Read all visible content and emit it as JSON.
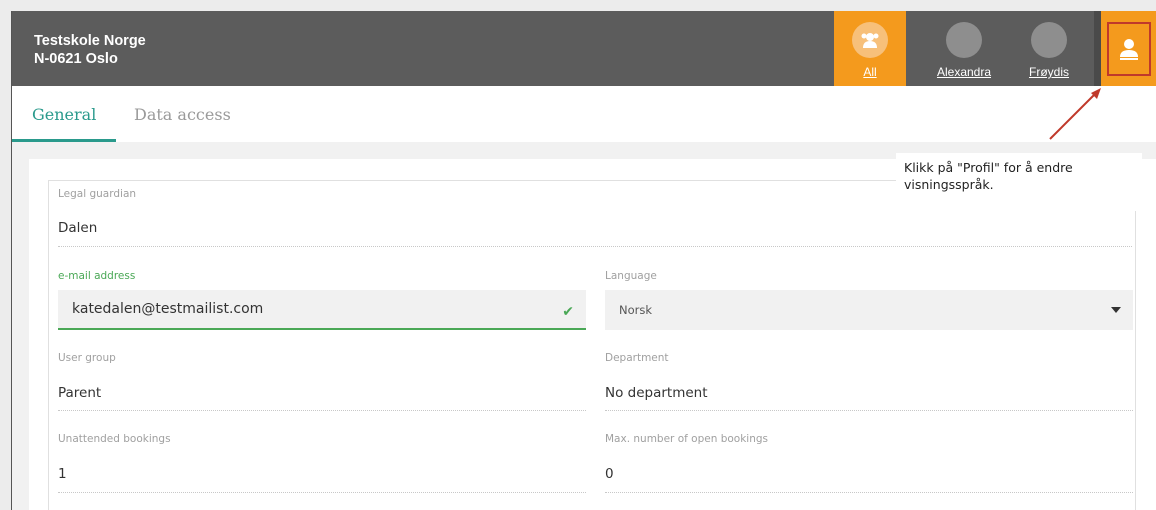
{
  "header": {
    "school_name": "Testskole Norge",
    "school_address": "N-0621 Oslo",
    "users": [
      {
        "label": "All",
        "icon": "group-icon",
        "active": true
      },
      {
        "label": "Alexandra",
        "icon": "avatar-placeholder"
      },
      {
        "label": "Frøydis",
        "icon": "avatar-placeholder"
      }
    ],
    "profile_icon": "person-icon",
    "accent": "#f49a1d"
  },
  "tabs": [
    {
      "label": "General",
      "active": true
    },
    {
      "label": "Data access",
      "active": false
    }
  ],
  "form": {
    "legal_guardian": {
      "label": "Legal guardian",
      "value": "Dalen"
    },
    "email": {
      "label": "e-mail address",
      "value": "katedalen@testmailist.com",
      "valid": true
    },
    "language": {
      "label": "Language",
      "value": "Norsk"
    },
    "user_group": {
      "label": "User group",
      "value": "Parent"
    },
    "department": {
      "label": "Department",
      "value": "No department"
    },
    "unattended": {
      "label": "Unattended bookings",
      "value": "1"
    },
    "max_open": {
      "label": "Max. number of open bookings",
      "value": "0"
    }
  },
  "callout": {
    "text": "Klikk på \"Profil\" for å endre visningsspråk."
  },
  "colors": {
    "teal": "#2a9a8c",
    "green": "#4aa856",
    "arrow": "#c0392b"
  }
}
